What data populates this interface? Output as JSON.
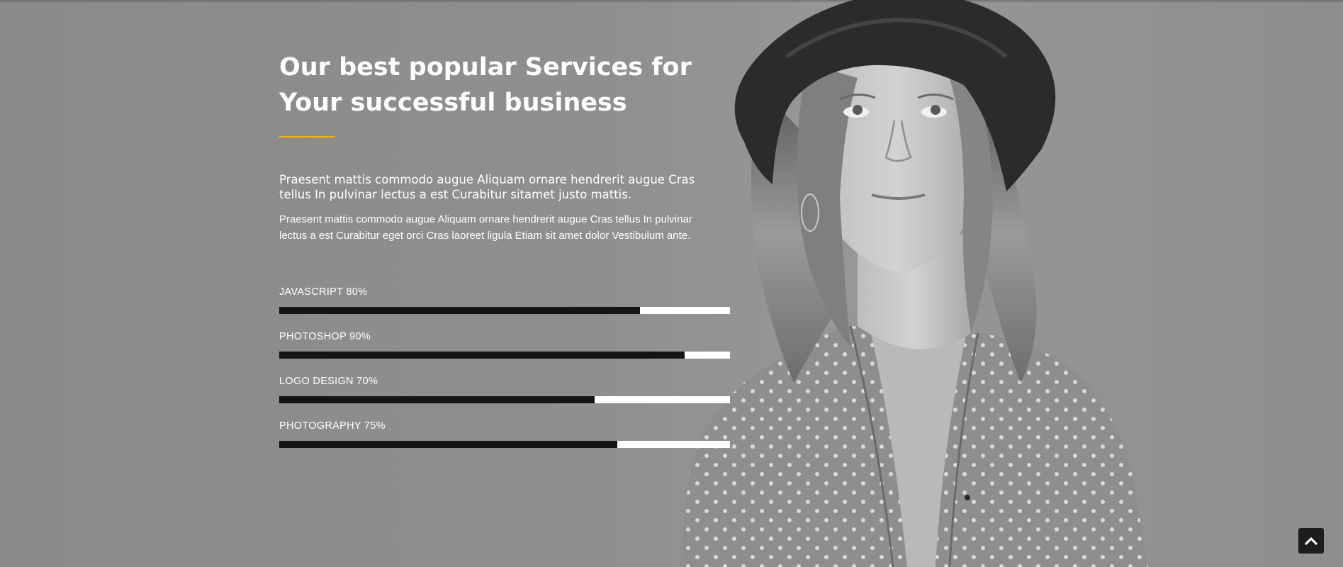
{
  "section": {
    "title_lines": [
      "Our best popular Services for",
      "Your successful business"
    ],
    "accent_color": "#f5b800",
    "lead_lines": [
      "Praesent mattis commodo augue Aliquam ornare hendrerit augue Cras",
      "tellus In pulvinar lectus a est Curabitur sitamet justo mattis."
    ],
    "body_lines": [
      "Praesent mattis commodo augue Aliquam ornare hendrerit augue Cras tellus In pulvinar",
      "lectus a est Curabitur eget orci Cras laoreet ligula Etiam sit amet dolor Vestibulum ante."
    ]
  },
  "skills": [
    {
      "label": "JAVASCRIPT 80%",
      "percent": 80
    },
    {
      "label": "PHOTOSHOP 90%",
      "percent": 90
    },
    {
      "label": "LOGO DESIGN 70%",
      "percent": 70
    },
    {
      "label": "PHOTOGRAPHY 75%",
      "percent": 75
    }
  ],
  "colors": {
    "background": "#8c8c8c",
    "bar_fill": "#151515",
    "bar_track": "#ffffff",
    "button_bg": "#1d1d1d"
  },
  "back_to_top": {
    "icon": "chevron-up-icon"
  },
  "portrait": {
    "subject": "portrait-photo"
  }
}
